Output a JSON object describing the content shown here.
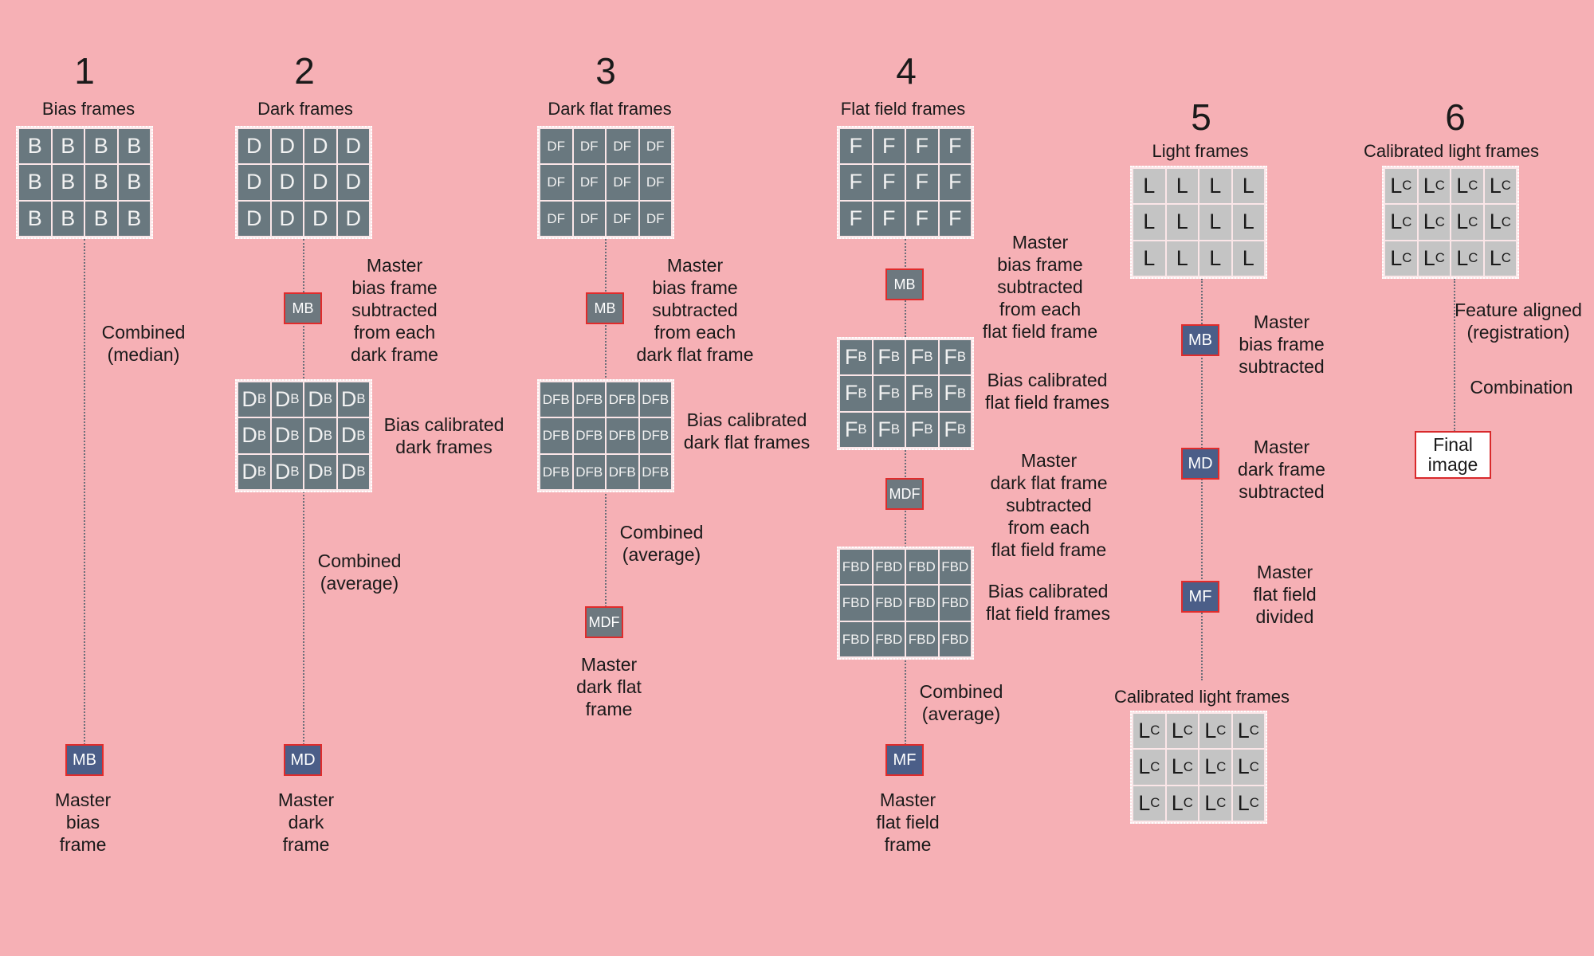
{
  "steps": [
    {
      "number": "1",
      "title": "Bias frames",
      "cell_labels": [
        "B"
      ],
      "master": "MB",
      "master_label": "Master\nbias\nframe",
      "process": "Combined\n(median)"
    },
    {
      "number": "2",
      "title": "Dark frames",
      "cell_labels": [
        "D"
      ],
      "subtract_box": "MB",
      "subtract_label": "Master\nbias frame\nsubtracted\nfrom each\ndark frame",
      "calibrated_cells": [
        "D",
        "B"
      ],
      "calibrated_label": "Bias calibrated\ndark frames",
      "process": "Combined\n(average)",
      "master": "MD",
      "master_label": "Master\ndark\nframe"
    },
    {
      "number": "3",
      "title": "Dark flat frames",
      "cell_labels": [
        "DF"
      ],
      "subtract_box": "MB",
      "subtract_label": "Master\nbias frame\nsubtracted\nfrom each\ndark flat frame",
      "calibrated_cells": [
        "DFB"
      ],
      "calibrated_label": "Bias calibrated\ndark flat frames",
      "process": "Combined\n(average)",
      "master": "MDF",
      "master_label": "Master\ndark flat\nframe"
    },
    {
      "number": "4",
      "title": "Flat field frames",
      "cell_labels": [
        "F"
      ],
      "subtract_box": "MB",
      "subtract_label": "Master\nbias frame\nsubtracted\nfrom each\nflat field frame",
      "calibrated_cells": [
        "F",
        "B"
      ],
      "calibrated_label": "Bias calibrated\nflat field frames",
      "subtract_box_2": "MDF",
      "subtract_label_2": "Master\ndark flat frame\nsubtracted\nfrom each\nflat field frame",
      "calibrated_cells_2": [
        "FBD"
      ],
      "calibrated_label_2": "Bias calibrated\nflat field frames",
      "process": "Combined\n(average)",
      "master": "MF",
      "master_label": "Master\nflat field\nframe"
    },
    {
      "number": "5",
      "title": "Light frames",
      "cell_labels": [
        "L"
      ],
      "ops": [
        {
          "box": "MB",
          "label": "Master\nbias frame\nsubtracted"
        },
        {
          "box": "MD",
          "label": "Master\ndark frame\nsubtracted"
        },
        {
          "box": "MF",
          "label": "Master\nflat field\ndivided"
        }
      ],
      "result_title": "Calibrated light frames",
      "result_cells": [
        "L",
        "C"
      ]
    },
    {
      "number": "6",
      "title": "Calibrated light frames",
      "cell_labels": [
        "L",
        "C"
      ],
      "process": "Feature aligned\n(registration)",
      "process_2": "Combination",
      "final": "Final\nimage"
    }
  ],
  "colors": {
    "background": "#f6b0b5",
    "frame_cell": "#69787f",
    "light_cell": "#c4c4c4",
    "master_blue": "#4b5e88",
    "master_gray": "#6d787f",
    "box_border": "#e02b2b"
  }
}
